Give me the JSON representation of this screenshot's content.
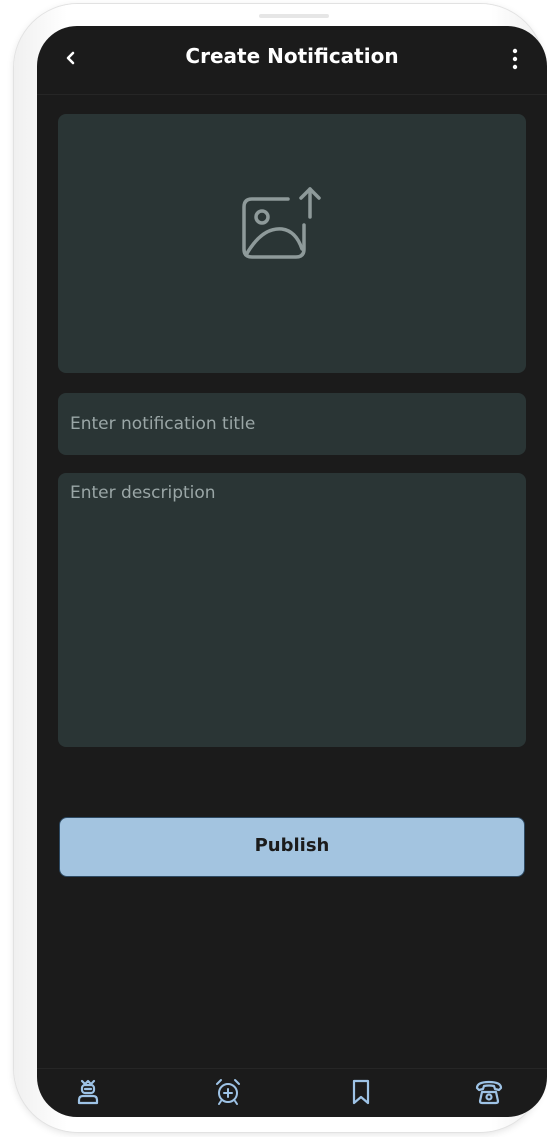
{
  "header": {
    "title": "Create Notification",
    "back_icon": "chevron-left-icon",
    "menu_icon": "more-vertical-icon"
  },
  "image_upload": {
    "icon": "image-upload-icon"
  },
  "title_input": {
    "placeholder": "Enter notification title",
    "value": ""
  },
  "description_input": {
    "placeholder": "Enter description",
    "value": ""
  },
  "publish": {
    "label": "Publish"
  },
  "bottom_nav": {
    "items": [
      {
        "icon": "user-admin-icon"
      },
      {
        "icon": "alarm-add-icon"
      },
      {
        "icon": "bookmark-icon"
      },
      {
        "icon": "phone-icon"
      }
    ]
  },
  "colors": {
    "background": "#1b1b1b",
    "surface": "#2a3535",
    "placeholder": "#9aa6a6",
    "accent": "#a3c4e0",
    "icon": "#9ec3e6",
    "text": "#ffffff"
  }
}
